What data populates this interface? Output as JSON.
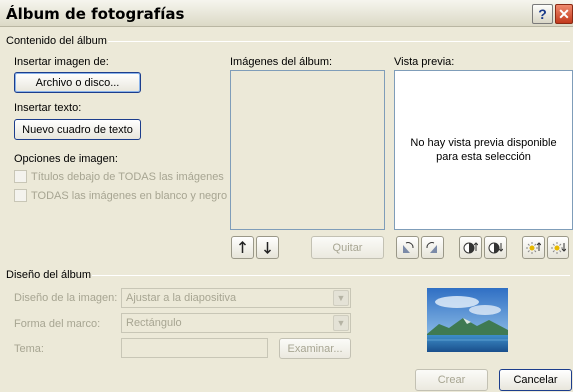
{
  "window": {
    "title": "Álbum de fotografías",
    "help_glyph": "?",
    "close_glyph": "✕"
  },
  "contents": {
    "group_label": "Contenido del álbum",
    "insert_image_label": "Insertar imagen de:",
    "file_button": "Archivo o disco...",
    "insert_text_label": "Insertar texto:",
    "new_textbox_button": "Nuevo cuadro de texto",
    "image_options_label": "Opciones de imagen:",
    "captions_checkbox": "Títulos debajo de TODAS las imágenes",
    "bw_checkbox": "TODAS las imágenes en blanco y negro",
    "album_images_label": "Imágenes del álbum:",
    "preview_label": "Vista previa:",
    "preview_message_line1": "No hay vista previa disponible",
    "preview_message_line2": "para esta selección",
    "remove_button": "Quitar"
  },
  "layout_section": {
    "group_label": "Diseño del álbum",
    "image_layout_label": "Diseño de la imagen:",
    "image_layout_value": "Ajustar a la diapositiva",
    "frame_shape_label": "Forma del marco:",
    "frame_shape_value": "Rectángulo",
    "theme_label": "Tema:",
    "theme_value": "",
    "browse_button": "Examinar..."
  },
  "footer": {
    "create_button": "Crear",
    "cancel_button": "Cancelar"
  },
  "icons": [
    "move-up-icon",
    "move-down-icon",
    "rotate-left-icon",
    "rotate-right-icon",
    "contrast-up-icon",
    "contrast-down-icon",
    "brightness-up-icon",
    "brightness-down-icon"
  ]
}
